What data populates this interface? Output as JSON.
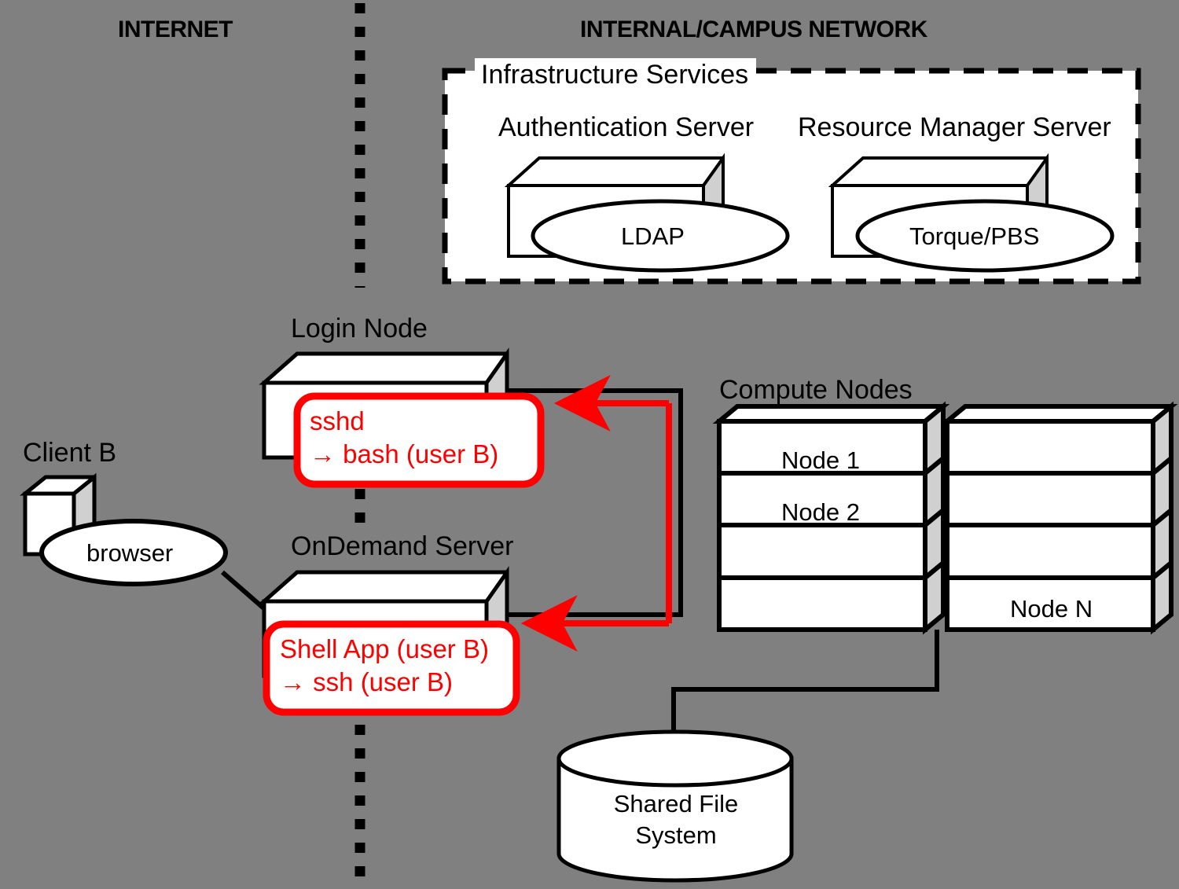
{
  "diagram": {
    "title": "Open OnDemand Shell App architecture",
    "background_color": "#808080",
    "accent_color": "#ff0000",
    "line_color": "#000000",
    "surface_color": "#ffffff",
    "shade_color": "#d0d0d0"
  },
  "zones": {
    "left_header": "INTERNET",
    "right_header": "INTERNAL/CAMPUS NETWORK"
  },
  "infrastructure": {
    "group_label": "Infrastructure Services",
    "servers": [
      {
        "title": "Authentication Server",
        "service": "LDAP"
      },
      {
        "title": "Resource Manager Server",
        "service": "Torque/PBS"
      }
    ]
  },
  "client": {
    "title": "Client B",
    "service": "browser"
  },
  "login_node": {
    "title": "Login Node",
    "callout": {
      "line1": "sshd",
      "line2": "→ bash (user B)"
    }
  },
  "ondemand_server": {
    "title": "OnDemand Server",
    "callout": {
      "line1": "Shell App (user B)",
      "line2": "→ ssh (user B)"
    }
  },
  "compute_nodes": {
    "title": "Compute Nodes",
    "rack_left": [
      "Node 1",
      "Node 2",
      "",
      ""
    ],
    "rack_right": [
      "",
      "",
      "",
      "Node N"
    ]
  },
  "storage": {
    "label_line1": "Shared File",
    "label_line2": "System"
  }
}
